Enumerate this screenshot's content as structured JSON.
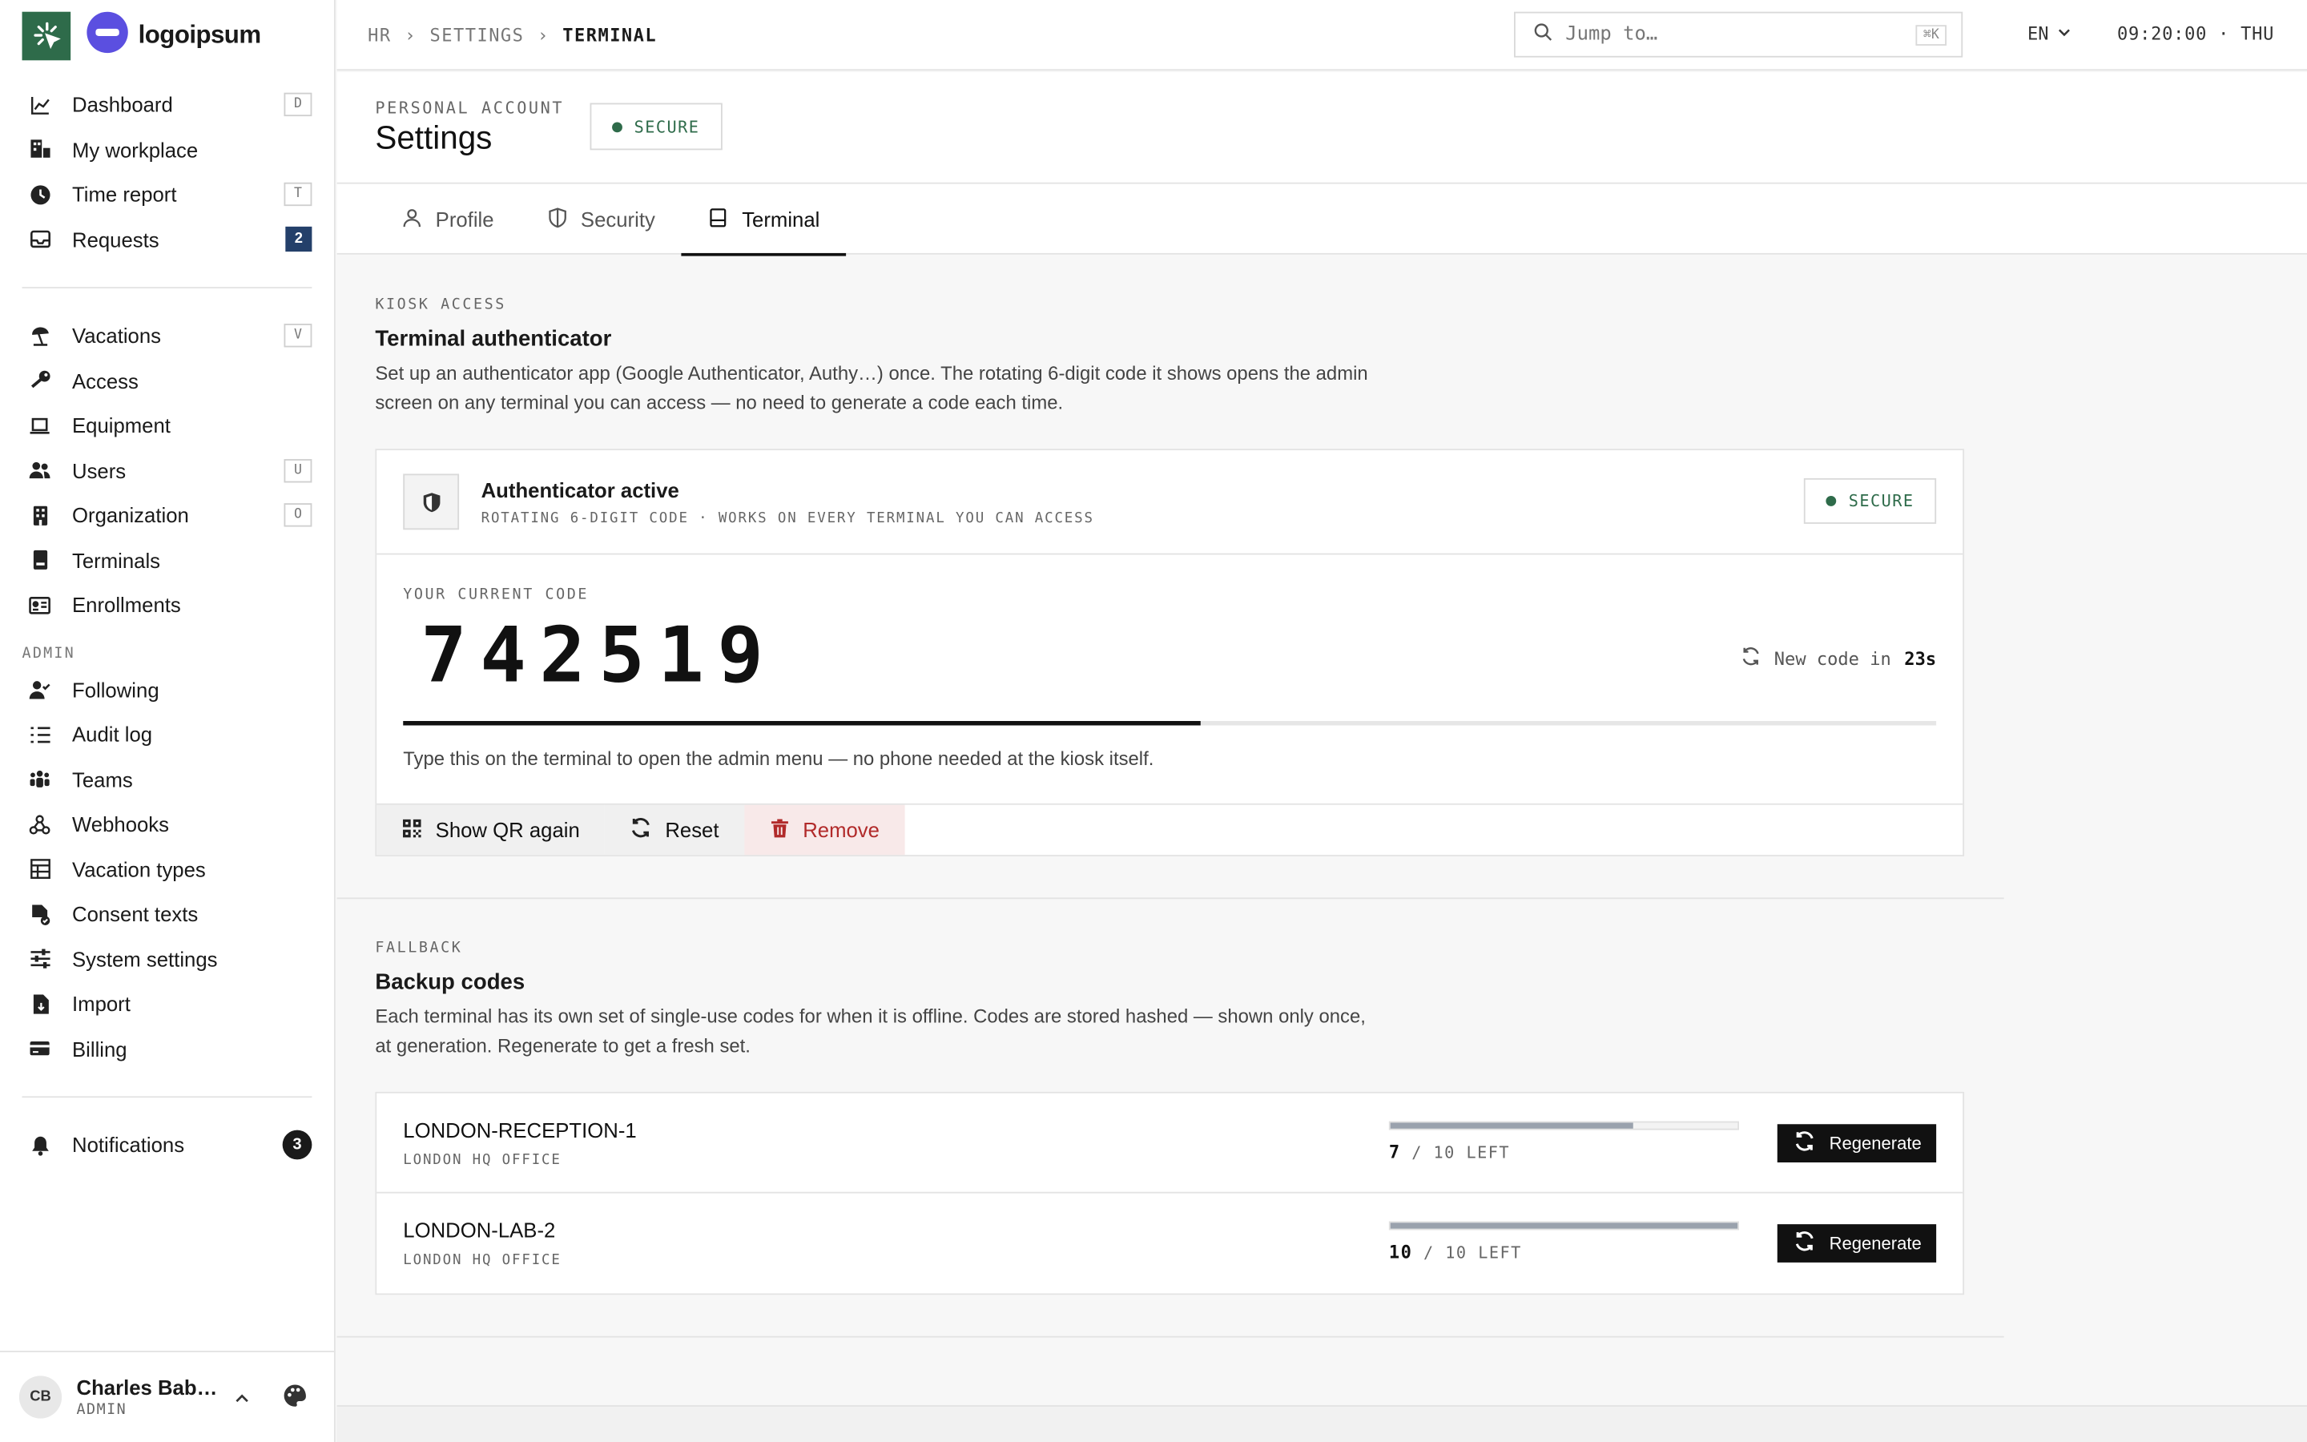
{
  "brand": {
    "name": "logoipsum"
  },
  "sidebar": {
    "items_top": [
      {
        "label": "Dashboard",
        "icon": "chart-line-icon",
        "kbd": "D"
      },
      {
        "label": "My workplace",
        "icon": "workplace-icon",
        "kbd": ""
      },
      {
        "label": "Time report",
        "icon": "clock-icon",
        "kbd": "T"
      },
      {
        "label": "Requests",
        "icon": "inbox-icon",
        "badge": "2"
      }
    ],
    "items_mid": [
      {
        "label": "Vacations",
        "icon": "beach-icon",
        "kbd": "V"
      },
      {
        "label": "Access",
        "icon": "key-icon",
        "kbd": ""
      },
      {
        "label": "Equipment",
        "icon": "laptop-icon",
        "kbd": ""
      },
      {
        "label": "Users",
        "icon": "users-icon",
        "kbd": "U"
      },
      {
        "label": "Organization",
        "icon": "building-icon",
        "kbd": "O"
      },
      {
        "label": "Terminals",
        "icon": "terminal-icon",
        "kbd": ""
      },
      {
        "label": "Enrollments",
        "icon": "id-card-icon",
        "kbd": ""
      }
    ],
    "admin_label": "ADMIN",
    "items_admin": [
      {
        "label": "Following",
        "icon": "user-check-icon"
      },
      {
        "label": "Audit log",
        "icon": "list-icon"
      },
      {
        "label": "Teams",
        "icon": "team-icon"
      },
      {
        "label": "Webhooks",
        "icon": "webhook-icon"
      },
      {
        "label": "Vacation types",
        "icon": "table-icon"
      },
      {
        "label": "Consent texts",
        "icon": "file-consent-icon"
      },
      {
        "label": "System settings",
        "icon": "sliders-icon"
      },
      {
        "label": "Import",
        "icon": "file-import-icon"
      },
      {
        "label": "Billing",
        "icon": "card-icon"
      }
    ],
    "notifications": {
      "label": "Notifications",
      "badge": "3"
    },
    "user": {
      "initials": "CB",
      "name": "Charles Bab…",
      "role": "ADMIN"
    }
  },
  "topbar": {
    "breadcrumb": [
      "HR",
      "SETTINGS",
      "TERMINAL"
    ],
    "search_placeholder": "Jump to…",
    "search_kbd": "⌘K",
    "lang": "EN",
    "clock": "09:20:00 · THU"
  },
  "header": {
    "eyebrow": "PERSONAL ACCOUNT",
    "title": "Settings",
    "badge": "SECURE"
  },
  "tabs": [
    {
      "label": "Profile",
      "icon": "user-icon"
    },
    {
      "label": "Security",
      "icon": "shield-icon"
    },
    {
      "label": "Terminal",
      "icon": "tablet-icon",
      "active": true
    }
  ],
  "kiosk": {
    "eyebrow": "KIOSK ACCESS",
    "title": "Terminal authenticator",
    "desc": "Set up an authenticator app (Google Authenticator, Authy…) once. The rotating 6-digit code it shows opens the admin screen on any terminal you can access — no need to generate a code each time.",
    "card_title": "Authenticator active",
    "card_sub": "ROTATING 6-DIGIT CODE · WORKS ON EVERY TERMINAL YOU CAN ACCESS",
    "card_badge": "SECURE",
    "code_label": "YOUR CURRENT CODE",
    "code": "742519",
    "new_code_prefix": "New code in",
    "new_code_secs": "23s",
    "progress": 0.52,
    "hint": "Type this on the terminal to open the admin menu — no phone needed at the kiosk itself.",
    "actions": {
      "show_qr": "Show QR again",
      "reset": "Reset",
      "remove": "Remove"
    }
  },
  "fallback": {
    "eyebrow": "FALLBACK",
    "title": "Backup codes",
    "desc": "Each terminal has its own set of single-use codes for when it is offline. Codes are stored hashed — shown only once, at generation. Regenerate to get a fresh set.",
    "terminals": [
      {
        "name": "LONDON-RECEPTION-1",
        "location": "LONDON HQ OFFICE",
        "left": "7",
        "total": "/ 10 LEFT",
        "fraction": 0.7,
        "button": "Regenerate"
      },
      {
        "name": "LONDON-LAB-2",
        "location": "LONDON HQ OFFICE",
        "left": "10",
        "total": "/ 10 LEFT",
        "fraction": 1.0,
        "button": "Regenerate"
      }
    ]
  },
  "colors": {
    "brand_green": "#2e6b4a",
    "danger": "#b12a2a",
    "badge_blue": "#24406a"
  }
}
